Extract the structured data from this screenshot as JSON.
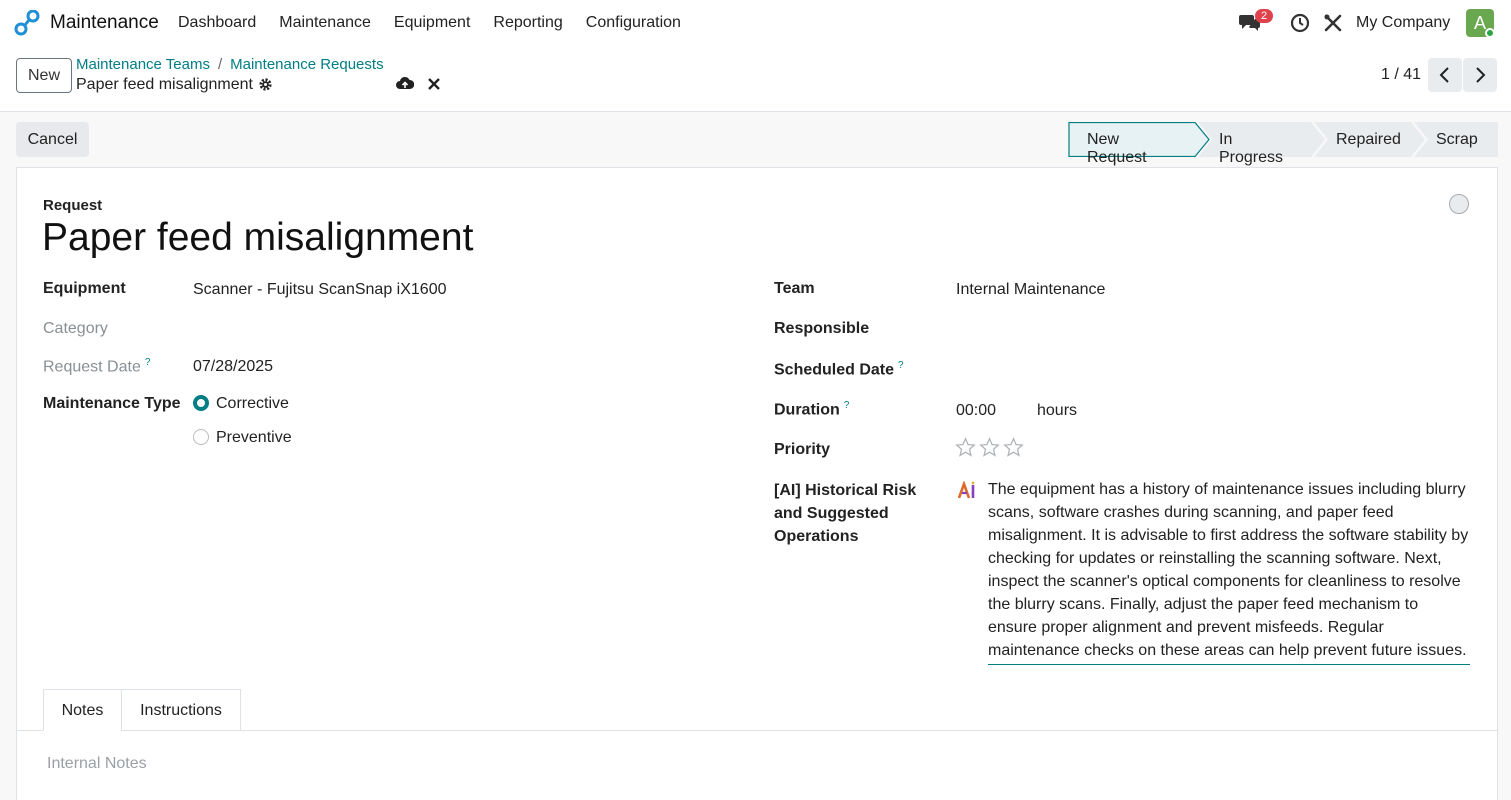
{
  "navbar": {
    "app_name": "Maintenance",
    "menu": [
      "Dashboard",
      "Maintenance",
      "Equipment",
      "Reporting",
      "Configuration"
    ],
    "chat_count": "2",
    "company": "My Company",
    "avatar_letter": "A"
  },
  "control": {
    "new_label": "New",
    "breadcrumbs": [
      "Maintenance Teams",
      "Maintenance Requests"
    ],
    "breadcrumb_sep": "/",
    "record_name": "Paper feed misalignment",
    "pager": "1 / 41"
  },
  "actions": {
    "cancel_label": "Cancel"
  },
  "stages": [
    "New Request",
    "In Progress",
    "Repaired",
    "Scrap"
  ],
  "form": {
    "request_label": "Request",
    "title": "Paper feed misalignment",
    "equipment_label": "Equipment",
    "equipment_value": "Scanner - Fujitsu ScanSnap iX1600",
    "category_label": "Category",
    "request_date_label": "Request Date",
    "request_date_value": "07/28/2025",
    "maintenance_type_label": "Maintenance Type",
    "maintenance_type_options": [
      "Corrective",
      "Preventive"
    ],
    "team_label": "Team",
    "team_value": "Internal Maintenance",
    "responsible_label": "Responsible",
    "scheduled_date_label": "Scheduled Date",
    "duration_label": "Duration",
    "duration_value": "00:00",
    "duration_unit": "hours",
    "priority_label": "Priority",
    "ai_label": "[AI] Historical Risk and Suggested Operations",
    "ai_text": "The equipment has a history of maintenance issues including blurry scans, software crashes during scanning, and paper feed misalignment. It is advisable to first address the software stability by checking for updates or reinstalling the scanning software. Next, inspect the scanner's optical components for cleanliness to resolve the blurry scans. Finally, adjust the paper feed mechanism to ensure proper alignment and prevent misfeeds. Regular maintenance checks on these areas can help prevent future issues.",
    "help_mark": "?"
  },
  "tabs": [
    "Notes",
    "Instructions"
  ],
  "notes_placeholder": "Internal Notes",
  "colors": {
    "accent": "#017e84",
    "badge": "#e0424b"
  }
}
